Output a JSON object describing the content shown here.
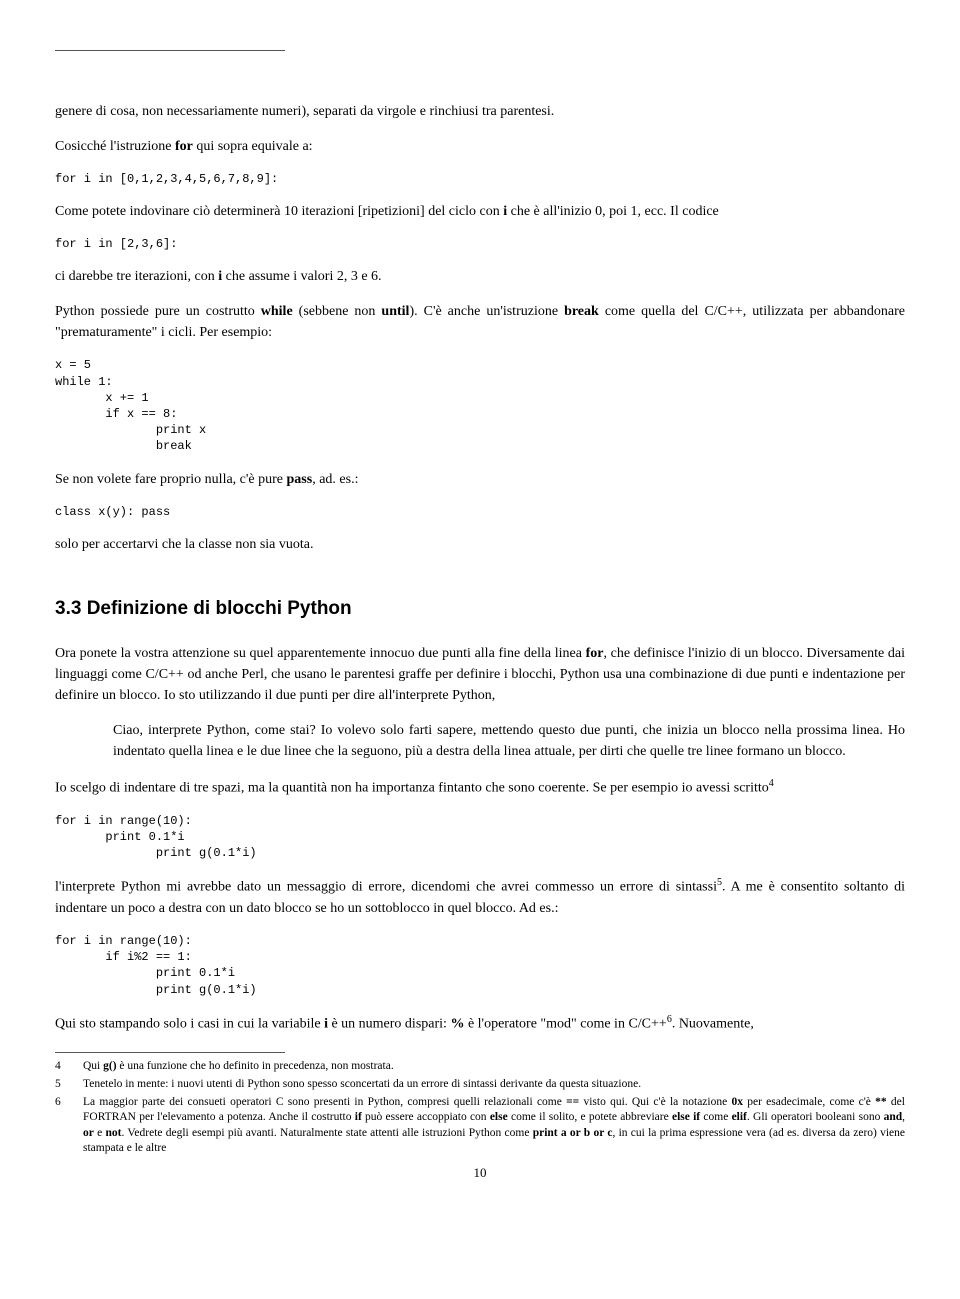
{
  "p1": "genere di cosa, non necessariamente numeri), separati da virgole e rinchiusi tra parentesi.",
  "p2a": "Cosicché l'istruzione ",
  "p2b": "for",
  "p2c": " qui sopra equivale a:",
  "code1": "for i in [0,1,2,3,4,5,6,7,8,9]:",
  "p3a": "Come potete indovinare ciò determinerà 10 iterazioni [ripetizioni] del ciclo con ",
  "p3b": "i",
  "p3c": " che è all'inizio 0, poi 1, ecc. Il codice",
  "code2": "for i in [2,3,6]:",
  "p4a": "ci darebbe tre iterazioni, con ",
  "p4b": "i",
  "p4c": " che assume i valori 2, 3 e 6.",
  "p5a": "Python possiede pure un costrutto ",
  "p5b": "while",
  "p5c": " (sebbene non ",
  "p5d": "until",
  "p5e": "). C'è anche un'istruzione ",
  "p5f": "break",
  "p5g": " come quella del C/C++, utilizzata per abbandonare \"prematuramente\" i cicli. Per esempio:",
  "code3": "x = 5\nwhile 1:\n       x += 1\n       if x == 8:\n              print x\n              break",
  "p6a": "Se non volete fare proprio nulla, c'è pure ",
  "p6b": "pass",
  "p6c": ", ad. es.:",
  "code4": "class x(y): pass",
  "p7": "solo per accertarvi che la classe non sia vuota.",
  "h2": "3.3   Definizione di blocchi Python",
  "p8a": "Ora ponete la vostra attenzione su quel apparentemente innocuo due punti alla fine della linea ",
  "p8b": "for",
  "p8c": ", che definisce l'inizio di un blocco. Diversamente dai linguaggi come C/C++ od anche Perl, che usano le parentesi graffe per definire i blocchi, Python usa una combinazione di due punti e indentazione per definire un blocco. Io sto utilizzando il due punti per dire all'interprete Python,",
  "quote": "Ciao, interprete Python, come stai? Io volevo solo farti sapere, mettendo questo due punti, che inizia un blocco nella prossima linea. Ho indentato quella linea e le due linee che la seguono, più a destra della linea attuale, per dirti che quelle tre linee formano un blocco.",
  "p9": "Io scelgo di indentare di tre spazi, ma la quantità non ha importanza fintanto che sono coerente. Se per esempio io avessi scritto",
  "sup4": "4",
  "code5": "for i in range(10):\n       print 0.1*i\n              print g(0.1*i)",
  "p10a": "l'interprete Python mi avrebbe dato un messaggio di errore, dicendomi che avrei commesso un errore di sintassi",
  "sup5": "5",
  "p10b": ". A me è consentito soltanto di indentare un poco a destra con un dato blocco se ho un sottoblocco in quel blocco. Ad es.:",
  "code6": "for i in range(10):\n       if i%2 == 1:\n              print 0.1*i\n              print g(0.1*i)",
  "p11a": "Qui sto stampando solo i casi in cui la variabile ",
  "p11b": "i",
  "p11c": " è un numero dispari: ",
  "p11d": "%",
  "p11e": " è l'operatore \"mod\" come in C/C++",
  "sup6": "6",
  "p11f": ". Nuovamente,",
  "fn4num": "4",
  "fn4a": "Qui ",
  "fn4b": "g()",
  "fn4c": " è una funzione che ho definito in precedenza, non mostrata.",
  "fn5num": "5",
  "fn5": "Tenetelo in mente: i nuovi utenti di Python sono spesso sconcertati da un errore di sintassi derivante da questa situazione.",
  "fn6num": "6",
  "fn6a": "La maggior parte dei consueti operatori C sono presenti in Python, compresi quelli relazionali come ",
  "fn6b": "==",
  "fn6c": " visto qui. Qui c'è la notazione ",
  "fn6d": "0x",
  "fn6e": " per esadecimale, come c'è ",
  "fn6f": "**",
  "fn6g": " del FORTRAN per l'elevamento a potenza. Anche il costrutto ",
  "fn6h": "if",
  "fn6i": " può essere accoppiato con ",
  "fn6j": "else",
  "fn6k": " come il solito, e potete abbreviare ",
  "fn6l": "else if",
  "fn6m": " come ",
  "fn6n": "elif",
  "fn6o": ". Gli operatori booleani sono ",
  "fn6p": "and",
  "fn6q": ", ",
  "fn6r": "or",
  "fn6s": " e ",
  "fn6t": "not",
  "fn6u": ". Vedrete degli esempi più avanti. Naturalmente state attenti alle istruzioni Python come ",
  "fn6v": "print a or b or c",
  "fn6w": ", in cui la prima espressione vera (ad es. diversa da zero) viene stampata e le altre",
  "pagenum": "10"
}
